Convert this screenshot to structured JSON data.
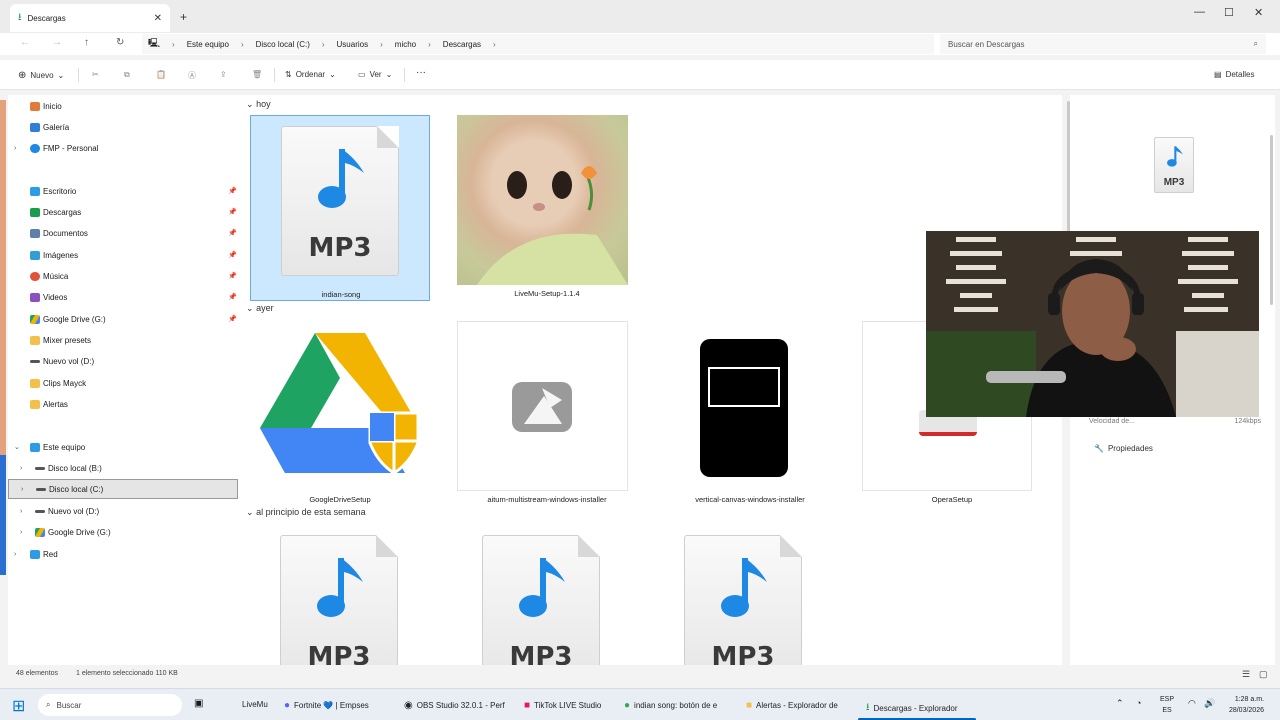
{
  "window": {
    "tab_title": "Descargas",
    "tab_close": "✕",
    "new_tab": "+",
    "min": "—",
    "max": "☐",
    "close": "✕"
  },
  "nav": {
    "breadcrumb": [
      "Este equipo",
      "Disco local (C:)",
      "Usuarios",
      "micho",
      "Descargas"
    ],
    "search_placeholder": "Buscar en Descargas"
  },
  "toolbar": {
    "new_label": "Nuevo",
    "sort_label": "Ordenar",
    "view_label": "Ver",
    "more_label": "···",
    "details_label": "Detalles"
  },
  "sidebar": {
    "items": [
      {
        "label": "Inicio",
        "icon": "home-icon",
        "color": "#e07b39"
      },
      {
        "label": "Galería",
        "icon": "gallery-icon",
        "color": "#2f7fd6"
      },
      {
        "label": "FMP - Personal",
        "icon": "cloud-icon",
        "color": "#1e88e5"
      },
      {
        "label": "Escritorio",
        "icon": "desktop-icon",
        "color": "#2e9be5"
      },
      {
        "label": "Descargas",
        "icon": "download-icon",
        "color": "#1b9e4b"
      },
      {
        "label": "Documentos",
        "icon": "documents-icon",
        "color": "#5f7fa8"
      },
      {
        "label": "Imágenes",
        "icon": "images-icon",
        "color": "#2f9fd6"
      },
      {
        "label": "Música",
        "icon": "music-icon",
        "color": "#e0533a"
      },
      {
        "label": "Videos",
        "icon": "video-icon",
        "color": "#8b4fc4"
      },
      {
        "label": "Google Drive (G:)",
        "icon": "google-drive-icon",
        "color": "#f2b400"
      },
      {
        "label": "Mixer presets",
        "icon": "folder-icon",
        "color": "#f3c14b"
      },
      {
        "label": "Nuevo vol (D:)",
        "icon": "drive-icon",
        "color": "#555555"
      },
      {
        "label": "Clips Mayck",
        "icon": "folder-icon",
        "color": "#f3c14b"
      },
      {
        "label": "Alertas",
        "icon": "folder-icon",
        "color": "#f3c14b"
      },
      {
        "label": "Este equipo",
        "icon": "computer-icon",
        "color": "#2e9be5"
      },
      {
        "label": "Disco local (B:)",
        "icon": "drive-icon",
        "color": "#555555"
      },
      {
        "label": "Disco local (C:)",
        "icon": "drive-icon",
        "color": "#555555"
      },
      {
        "label": "Nuevo vol (D:)",
        "icon": "drive-icon",
        "color": "#555555"
      },
      {
        "label": "Google Drive (G:)",
        "icon": "google-drive-icon",
        "color": "#f2b400"
      },
      {
        "label": "Red",
        "icon": "network-icon",
        "color": "#2e9be5"
      }
    ]
  },
  "groups": {
    "today": "hoy",
    "yesterday": "ayer",
    "this_week": "al principio de esta semana"
  },
  "files": {
    "f1": "indian-song",
    "f2": "LiveMu-Setup-1.1.4",
    "f3": "GoogleDriveSetup",
    "f4": "aitum-multistream-windows-installer",
    "f5": "vertical-canvas-windows-installer",
    "f6": "OperaSetup",
    "mp3": "MP3"
  },
  "details": {
    "speed_label": "Velocidad de...",
    "speed_value": "124kbps",
    "properties": "Propiedades"
  },
  "status": {
    "count": "48 elementos",
    "selection": "1 elemento seleccionado 110 KB"
  },
  "taskbar": {
    "search": "Buscar",
    "apps": [
      "LiveMu",
      "Fortnite 💙 | Empses",
      "OBS Studio 32.0.1 - Perf",
      "TikTok LIVE Studio",
      "indian song: botón de e",
      "Alertas - Explorador de",
      "Descargas - Explorador"
    ],
    "lang_top": "ESP",
    "lang_bottom": "ES",
    "time": "1:28 a.m.",
    "date": "28/03/2026"
  }
}
